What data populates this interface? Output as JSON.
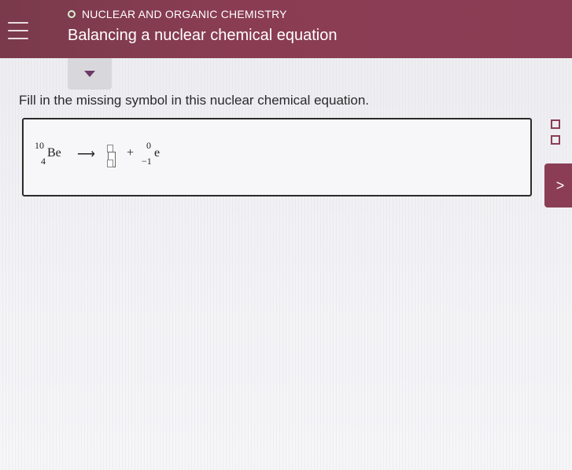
{
  "header": {
    "topic": "NUCLEAR AND ORGANIC CHEMISTRY",
    "title": "Balancing a nuclear chemical equation"
  },
  "instructions": "Fill in the missing symbol in this nuclear chemical equation.",
  "equation": {
    "reactant": {
      "mass": "10",
      "atomic": "4",
      "symbol": "Be"
    },
    "arrow": "⟶",
    "plus": "+",
    "product2": {
      "mass": "0",
      "atomic": "−1",
      "symbol": "e"
    }
  },
  "colors": {
    "header": "#8b3d55",
    "accent": "#6b3a66"
  },
  "icons": {
    "menu": "hamburger-icon",
    "topic_status": "circle-icon",
    "collapse": "triangle-down-icon",
    "next": "chevron-right-icon"
  },
  "next_glyph": ">"
}
